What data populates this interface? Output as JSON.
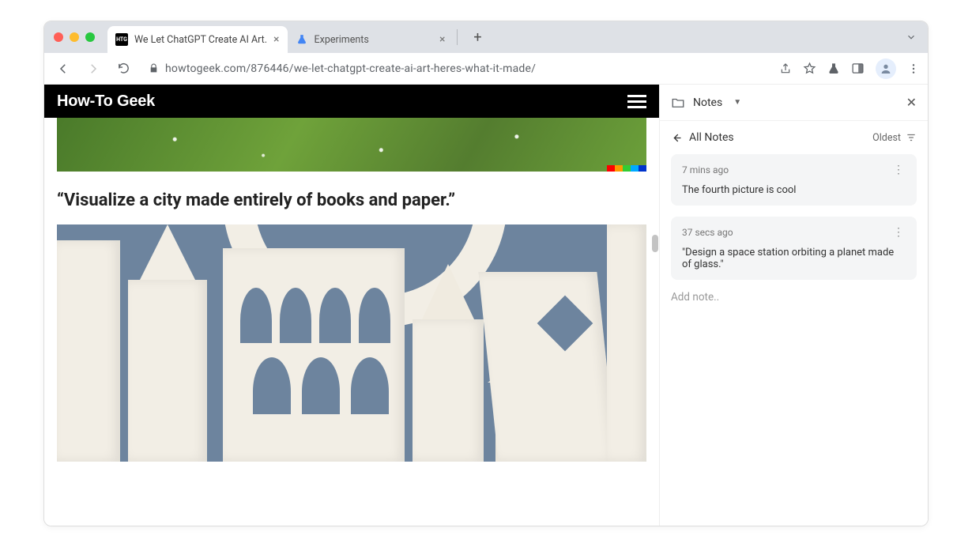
{
  "tabs": [
    {
      "title": "We Let ChatGPT Create AI Art.",
      "favicon": "HTG",
      "active": true
    },
    {
      "title": "Experiments",
      "favicon": "flask",
      "active": false
    }
  ],
  "url": "howtogeek.com/876446/we-let-chatgpt-create-ai-art-heres-what-it-made/",
  "site": {
    "logo": "How-To Geek"
  },
  "article": {
    "heading": "“Visualize a city made entirely of books and paper.”"
  },
  "sidepanel": {
    "title": "Notes",
    "back_label": "All Notes",
    "sort_label": "Oldest",
    "add_placeholder": "Add note..",
    "notes": [
      {
        "time": "7 mins ago",
        "text": "The fourth picture is cool"
      },
      {
        "time": "37 secs ago",
        "text": "\"Design a space station orbiting a planet made of glass.\""
      }
    ]
  },
  "colors": {
    "palette": [
      "#ff0000",
      "#ff9900",
      "#33cc33",
      "#00aaff",
      "#0033cc"
    ]
  }
}
